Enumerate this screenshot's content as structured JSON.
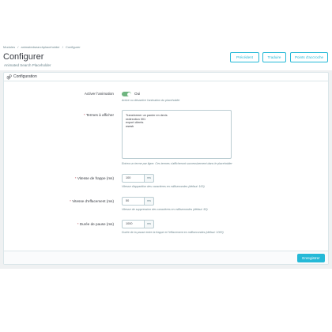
{
  "breadcrumb": [
    "Modules",
    "animatedsearchplaceholder",
    "Configurer"
  ],
  "breadcrumb_sep": "/",
  "page": {
    "title": "Configurer",
    "subtitle": "Animated Search Placeholder"
  },
  "header_buttons": {
    "back": "Précédent",
    "translate": "Traduire",
    "hooks": "Points d'accroche"
  },
  "panel": {
    "title": "Configuration"
  },
  "fields": {
    "enable": {
      "label": "Activer l'animation",
      "value_label": "Oui",
      "enabled": true,
      "help": "Active ou désactive l'animation du placeholder"
    },
    "terms": {
      "label": "Termes à afficher",
      "lines": [
        "Transformer un panier en devis",
        "redirection 301",
        "export clients",
        "wwwk"
      ],
      "help": "Entrez un terme par ligne. Ces termes s'afficheront successivement dans le placeholder"
    },
    "typing_speed": {
      "label": "Vitesse de frappe (ms)",
      "value": "100",
      "unit": "ms",
      "help": "Vitesse d'apparition des caractères en millisecondes (défaut: 100)"
    },
    "delete_speed": {
      "label": "Vitesse d'effacement (ms)",
      "value": "50",
      "unit": "ms",
      "help": "Vitesse de suppression des caractères en millisecondes (défaut: 50)"
    },
    "pause": {
      "label": "Durée de pause (ms)",
      "value": "1000",
      "unit": "ms",
      "help": "Durée de la pause entre la frappe et l'effacement en millisecondes (défaut: 1000)"
    }
  },
  "footer": {
    "save_label": "Enregistrer"
  },
  "colors": {
    "primary": "#25b9d7",
    "toggle_on": "#70b580",
    "required": "#c05c67"
  },
  "icons": {
    "panel": "gears-icon"
  }
}
